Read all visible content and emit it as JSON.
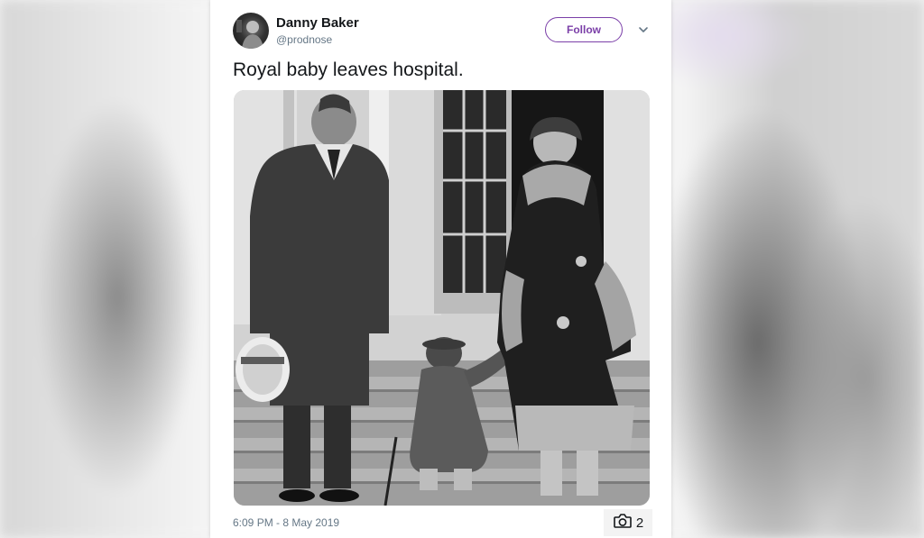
{
  "tweet": {
    "user": {
      "name": "Danny Baker",
      "handle": "@prodnose"
    },
    "follow_label": "Follow",
    "text": "Royal baby leaves hospital.",
    "timestamp": "6:09 PM - 8 May 2019",
    "photo_count": "2",
    "icons": {
      "menu": "chevron-down-icon",
      "photos": "camera-icon"
    },
    "colors": {
      "accent": "#7b3fa8",
      "text": "#14171a",
      "muted": "#657786"
    }
  }
}
